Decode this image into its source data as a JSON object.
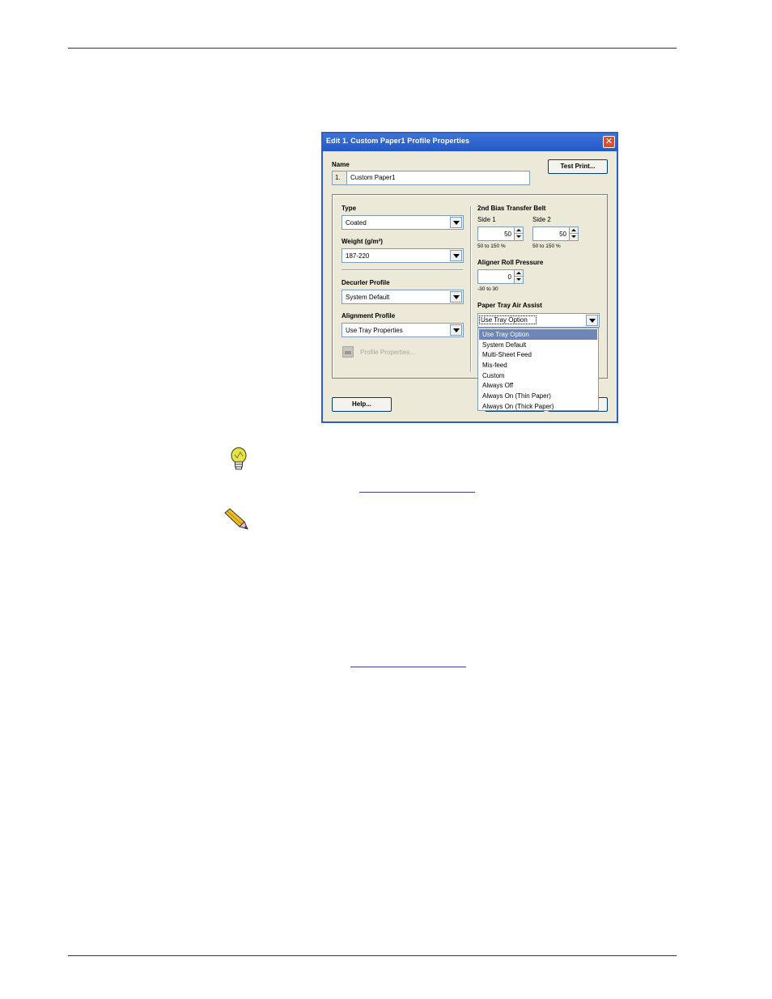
{
  "dialog": {
    "title": "Edit 1. Custom Paper1 Profile Properties",
    "close_glyph": "✕",
    "name": {
      "label": "Name",
      "prefix": "1.",
      "value": "Custom Paper1"
    },
    "test_print_button": "Test Print...",
    "type": {
      "label": "Type",
      "value": "Coated"
    },
    "weight": {
      "label": "Weight (g/m²)",
      "value": "187-220"
    },
    "decurler": {
      "label": "Decurler Profile",
      "value": "System Default"
    },
    "alignment": {
      "label": "Alignment Profile",
      "value": "Use Tray Properties"
    },
    "profile_properties_button": "Profile Properties...",
    "bias_belt": {
      "label": "2nd Bias Transfer Belt",
      "side1": {
        "label": "Side 1",
        "value": "50",
        "range": "50 to 150 %"
      },
      "side2": {
        "label": "Side 2",
        "value": "50",
        "range": "50 to 150 %"
      }
    },
    "aligner": {
      "label": "Aligner Roll Pressure",
      "value": "0",
      "range": "-30 to 30"
    },
    "air_assist": {
      "label": "Paper Tray Air Assist",
      "value": "Use Tray Option",
      "options": [
        "Use Tray Option",
        "System Default",
        "Multi-Sheet Feed",
        "Mis-feed",
        "Custom",
        "Always Off",
        "Always On (Thin Paper)",
        "Always On (Thick Paper)"
      ],
      "selected_index": 0
    },
    "help_button": "Help..."
  },
  "icons": {
    "tip": "lightbulb-icon",
    "note": "pencil-icon"
  },
  "colors": {
    "rule": "#2a2f8f",
    "titlebar": "#2358c8",
    "selection": "#6d86b7"
  }
}
